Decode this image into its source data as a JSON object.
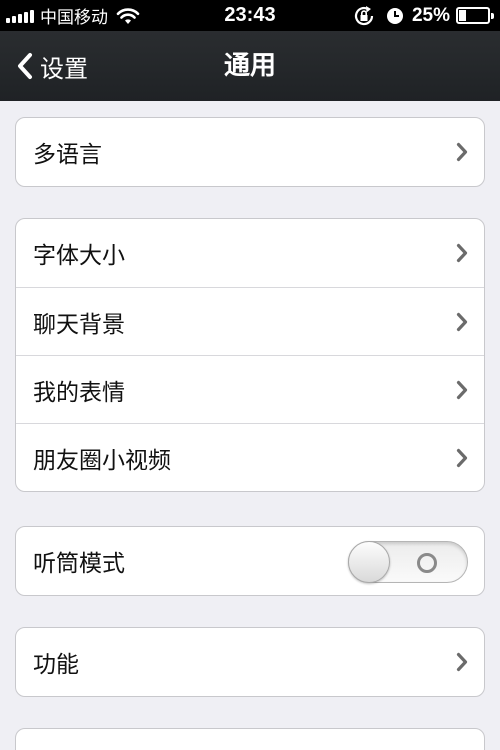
{
  "status_bar": {
    "carrier": "中国移动",
    "time": "23:43",
    "battery_percent": "25%",
    "battery_level": 0.25,
    "icons": [
      "signal-icon",
      "wifi-icon",
      "rotation-lock-icon",
      "alarm-icon",
      "battery-icon"
    ]
  },
  "nav": {
    "back_label": "设置",
    "title": "通用"
  },
  "groups": [
    {
      "rows": [
        {
          "label": "多语言"
        }
      ]
    },
    {
      "rows": [
        {
          "label": "字体大小"
        },
        {
          "label": "聊天背景"
        },
        {
          "label": "我的表情"
        },
        {
          "label": "朋友圈小视频"
        }
      ]
    },
    {
      "rows": [
        {
          "label": "听筒模式",
          "toggle": false
        }
      ]
    },
    {
      "rows": [
        {
          "label": "功能"
        }
      ]
    }
  ],
  "colors": {
    "background": "#efeff4",
    "nav_bar": "#1f2225",
    "status_bar": "#000000"
  }
}
